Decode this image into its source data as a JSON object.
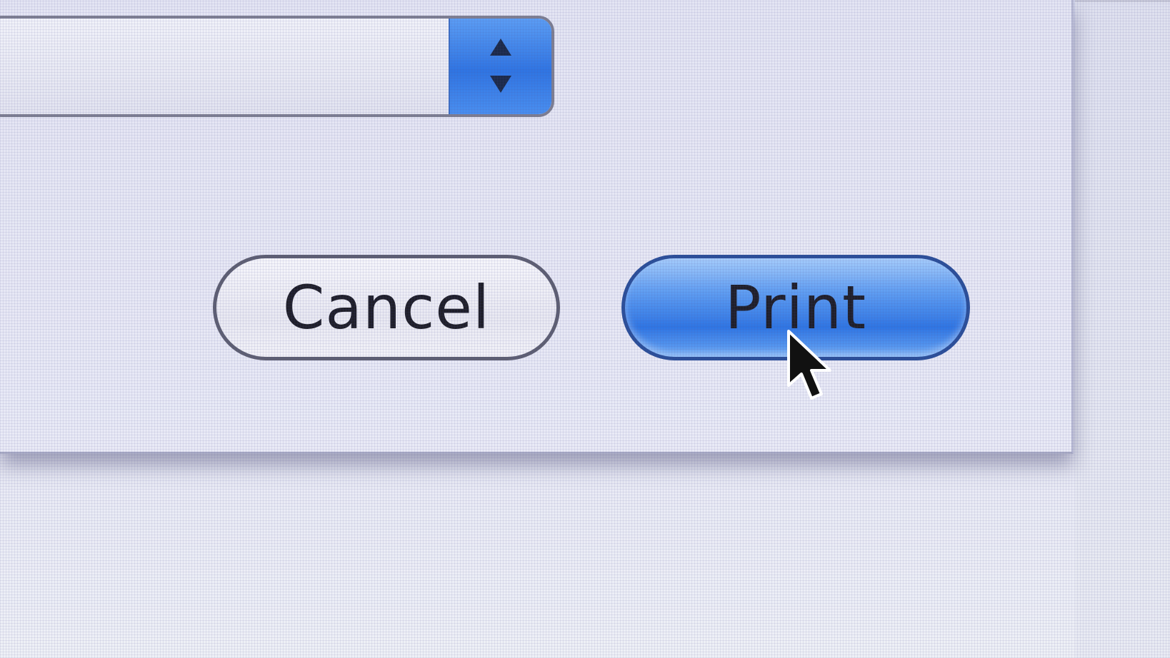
{
  "dialog": {
    "popup": {
      "value": "",
      "stepper_icons": [
        "arrow-up-icon",
        "arrow-down-icon"
      ]
    },
    "buttons": {
      "cancel_label": "Cancel",
      "print_label": "Print"
    },
    "default_button": "print"
  },
  "cursor": {
    "icon": "arrow-pointer-icon"
  },
  "colors": {
    "accent": "#2f76e4",
    "sheet_background": "#e6e7f4",
    "button_outline": "#5e5f72"
  }
}
